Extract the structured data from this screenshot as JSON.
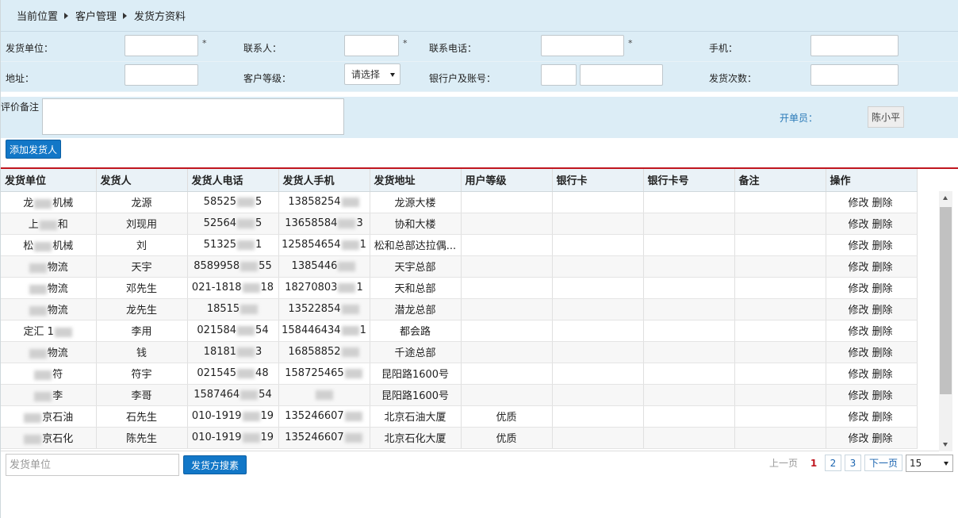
{
  "breadcrumb": [
    "当前位置",
    "客户管理",
    "发货方资料"
  ],
  "form": {
    "row1": [
      {
        "label": "发货单位：",
        "required": "*",
        "value": ""
      },
      {
        "label": "联系人：",
        "required": "*",
        "value": ""
      },
      {
        "label": "联系电话：",
        "required": "*",
        "value": ""
      },
      {
        "label": "手机：",
        "value": ""
      }
    ],
    "row2": {
      "address_label": "地址：",
      "level_label": "客户等级：",
      "level_value": "请选择",
      "bank_label": "银行户及账号：",
      "count_label": "发货次数："
    },
    "remark_label": "评价备注",
    "operator_label": "开单员：",
    "operator_value": "陈小平"
  },
  "add_button": "添加发货人",
  "table": {
    "headers": [
      "发货单位",
      "发货人",
      "发货人电话",
      "发货人手机",
      "发货地址",
      "用户等级",
      "银行卡",
      "银行卡号",
      "备注",
      "操作"
    ],
    "edit_label": "修改",
    "delete_label": "删除",
    "rows": [
      {
        "unit_a": "龙",
        "unit_b": "机械",
        "person": "龙源",
        "phone_a": "58525",
        "phone_b": "5",
        "mobile_a": "13858254",
        "mobile_b": "",
        "address": "龙源大楼",
        "level": ""
      },
      {
        "unit_a": "上",
        "unit_b": "和",
        "person": "刘现用",
        "phone_a": "52564",
        "phone_b": "5",
        "mobile_a": "13658584",
        "mobile_b": "3",
        "address": "协和大楼",
        "level": ""
      },
      {
        "unit_a": "松",
        "unit_b": "机械",
        "person": "刘",
        "phone_a": "51325",
        "phone_b": "1",
        "mobile_a": "125854654",
        "mobile_b": "1",
        "address": "松和总部达拉偶...",
        "level": ""
      },
      {
        "unit_a": "",
        "unit_b": "物流",
        "person": "天宇",
        "phone_a": "8589958",
        "phone_b": "55",
        "mobile_a": "1385446",
        "mobile_b": "",
        "address": "天宇总部",
        "level": ""
      },
      {
        "unit_a": "",
        "unit_b": "物流",
        "person": "邓先生",
        "phone_a": "021-1818",
        "phone_b": "18",
        "mobile_a": "18270803",
        "mobile_b": "1",
        "address": "天和总部",
        "level": ""
      },
      {
        "unit_a": "",
        "unit_b": "物流",
        "person": "龙先生",
        "phone_a": "18515",
        "phone_b": "",
        "mobile_a": "13522854",
        "mobile_b": "",
        "address": "潜龙总部",
        "level": ""
      },
      {
        "unit_a": "定汇 1",
        "unit_b": "",
        "person": "李用",
        "phone_a": "021584",
        "phone_b": "54",
        "mobile_a": "158446434",
        "mobile_b": "1",
        "address": "都会路",
        "level": ""
      },
      {
        "unit_a": "",
        "unit_b": "物流",
        "person": "钱",
        "phone_a": "18181",
        "phone_b": "3",
        "mobile_a": "16858852",
        "mobile_b": "",
        "address": "千途总部",
        "level": ""
      },
      {
        "unit_a": "",
        "unit_b": "符",
        "person": "符宇",
        "phone_a": "021545",
        "phone_b": "48",
        "mobile_a": "158725465",
        "mobile_b": "",
        "address": "昆阳路1600号",
        "level": ""
      },
      {
        "unit_a": "",
        "unit_b": "李",
        "person": "李哥",
        "phone_a": "1587464",
        "phone_b": "54",
        "mobile_a": "",
        "mobile_b": "",
        "address": "昆阳路1600号",
        "level": ""
      },
      {
        "unit_a": "",
        "unit_b": "京石油",
        "person": "石先生",
        "phone_a": "010-1919",
        "phone_b": "19",
        "mobile_a": "135246607",
        "mobile_b": "",
        "address": "北京石油大厦",
        "level": "优质"
      },
      {
        "unit_a": "",
        "unit_b": "京石化",
        "person": "陈先生",
        "phone_a": "010-1919",
        "phone_b": "19",
        "mobile_a": "135246607",
        "mobile_b": "",
        "address": "北京石化大厦",
        "level": "优质"
      }
    ]
  },
  "search": {
    "placeholder": "发货单位",
    "button": "发货方搜素"
  },
  "pagination": {
    "prev": "上一页",
    "pages": [
      "1",
      "2",
      "3"
    ],
    "current": "1",
    "next": "下一页",
    "page_size": "15"
  }
}
